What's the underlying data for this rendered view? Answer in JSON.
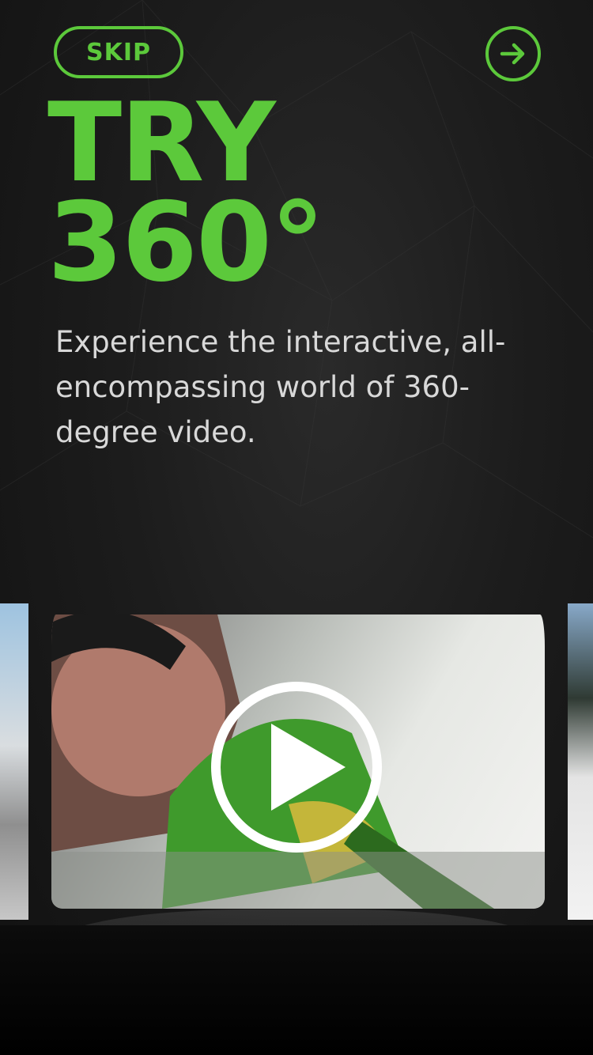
{
  "nav": {
    "skip_label": "SKIP",
    "next_icon": "arrow-right-icon"
  },
  "hero": {
    "line1": "TRY",
    "line2": "360°",
    "description": "Experience the interactive, all-encompassing world of 360-degree video."
  },
  "carousel": {
    "play_icon": "play-icon",
    "cards": [
      "left-preview",
      "kayak-preview",
      "right-preview"
    ]
  },
  "colors": {
    "accent": "#5cc93b",
    "background": "#151515",
    "text": "#d8d8d8"
  }
}
